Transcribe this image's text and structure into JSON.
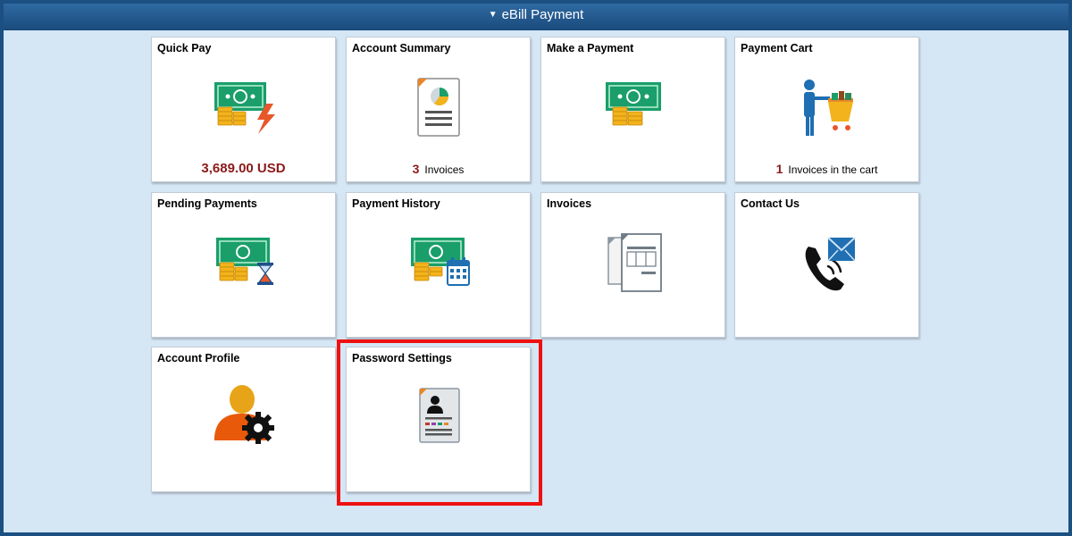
{
  "header": {
    "title": "eBill Payment"
  },
  "tiles": [
    {
      "title": "Quick Pay",
      "footer_amount": "3,689.00 USD"
    },
    {
      "title": "Account Summary",
      "footer_count": "3",
      "footer_text": "Invoices"
    },
    {
      "title": "Make a Payment"
    },
    {
      "title": "Payment Cart",
      "footer_count": "1",
      "footer_text": "Invoices in the cart"
    },
    {
      "title": "Pending Payments"
    },
    {
      "title": "Payment History"
    },
    {
      "title": "Invoices"
    },
    {
      "title": "Contact Us"
    },
    {
      "title": "Account Profile"
    },
    {
      "title": "Password Settings"
    }
  ],
  "highlight": {
    "target": "Password Settings",
    "color": "#ee1111"
  },
  "colors": {
    "accent_text": "#8b1a1a",
    "header_bg": "#1a4a7c",
    "page_bg": "#d5e6f5"
  }
}
